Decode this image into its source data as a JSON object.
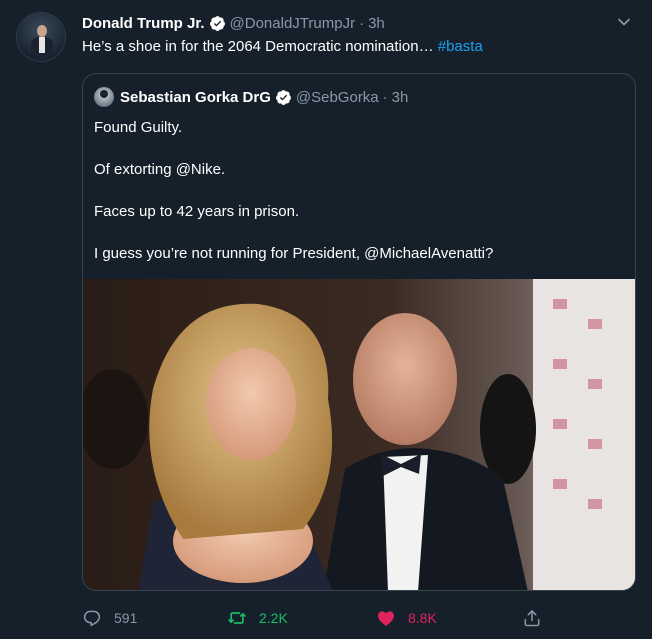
{
  "tweet": {
    "author_name": "Donald Trump Jr.",
    "author_handle": "@DonaldJTrumpJr",
    "separator": "·",
    "time": "3h",
    "text": "He’s a shoe in for the 2064 Democratic nomination… ",
    "hashtag": "#basta"
  },
  "quote": {
    "author_name": "Sebastian Gorka DrG",
    "author_handle": "@SebGorka",
    "separator": "·",
    "time": "3h",
    "lines": [
      "Found Guilty.",
      "Of extorting @Nike.",
      "Faces up to 42 years in prison.",
      "I guess you’re not running for President, @MichaelAvenatti?"
    ]
  },
  "actions": {
    "reply_count": "591",
    "retweet_count": "2.2K",
    "like_count": "8.8K"
  },
  "icons": {
    "verified": "verified-badge-icon",
    "caret": "chevron-down-icon",
    "reply": "reply-icon",
    "retweet": "retweet-icon",
    "like": "heart-icon",
    "share": "share-icon"
  },
  "colors": {
    "background": "#15202b",
    "secondary_text": "#8899a6",
    "link": "#1da1f2",
    "retweet_active": "#17bf63",
    "like_active": "#e0245e",
    "border": "#38444d"
  }
}
